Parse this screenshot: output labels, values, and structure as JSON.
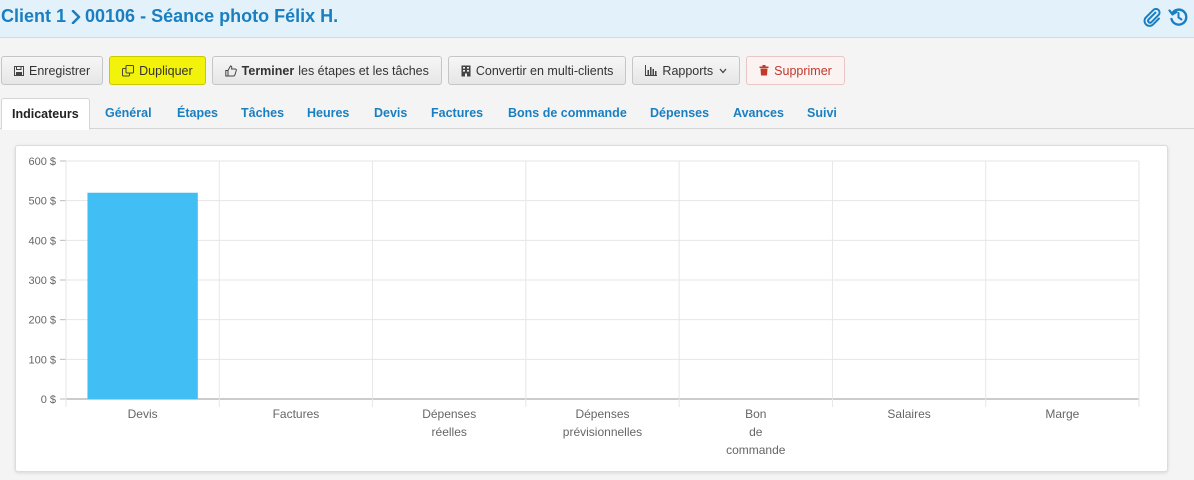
{
  "header": {
    "breadcrumb_parent": "Client 1",
    "breadcrumb_current": "00106 - Séance photo Félix H."
  },
  "toolbar": {
    "save_label": "Enregistrer",
    "duplicate_label": "Dupliquer",
    "finish_bold": "Terminer",
    "finish_rest": "les étapes et les tâches",
    "convert_label": "Convertir en multi-clients",
    "reports_label": "Rapports",
    "delete_label": "Supprimer"
  },
  "tabs": [
    {
      "label": "Indicateurs",
      "active": true
    },
    {
      "label": "Général"
    },
    {
      "label": "Étapes"
    },
    {
      "label": "Tâches"
    },
    {
      "label": "Heures"
    },
    {
      "label": "Devis"
    },
    {
      "label": "Factures"
    },
    {
      "label": "Bons de commande"
    },
    {
      "label": "Dépenses"
    },
    {
      "label": "Avances"
    },
    {
      "label": "Suivi"
    }
  ],
  "colors": {
    "accent": "#1a7fc1",
    "bar": "#41bff5",
    "header_bg": "#e3f1fb",
    "duplicate_bg": "#f2f20a",
    "delete_text": "#c0392b"
  },
  "icons": {
    "breadcrumb_separator": "chevron-right-icon",
    "attachment": "paperclip-icon",
    "history": "history-icon",
    "save": "save-icon",
    "duplicate": "duplicate-icon",
    "finish": "thumbs-up-icon",
    "convert": "building-icon",
    "reports": "bar-chart-icon",
    "reports_caret": "chevron-down-icon",
    "delete": "trash-icon"
  },
  "chart_data": {
    "type": "bar",
    "categories": [
      [
        "Devis"
      ],
      [
        "Factures"
      ],
      [
        "Dépenses",
        "réelles"
      ],
      [
        "Dépenses",
        "prévisionnelles"
      ],
      [
        "Bon",
        "de",
        "commande"
      ],
      [
        "Salaires"
      ],
      [
        "Marge"
      ]
    ],
    "values": [
      520,
      0,
      0,
      0,
      0,
      0,
      0
    ],
    "ylim": [
      0,
      600
    ],
    "yticks": [
      0,
      100,
      200,
      300,
      400,
      500,
      600
    ],
    "ytick_labels": [
      "0 $",
      "100 $",
      "200 $",
      "300 $",
      "400 $",
      "500 $",
      "600 $"
    ],
    "grid": true,
    "legend": "none"
  }
}
